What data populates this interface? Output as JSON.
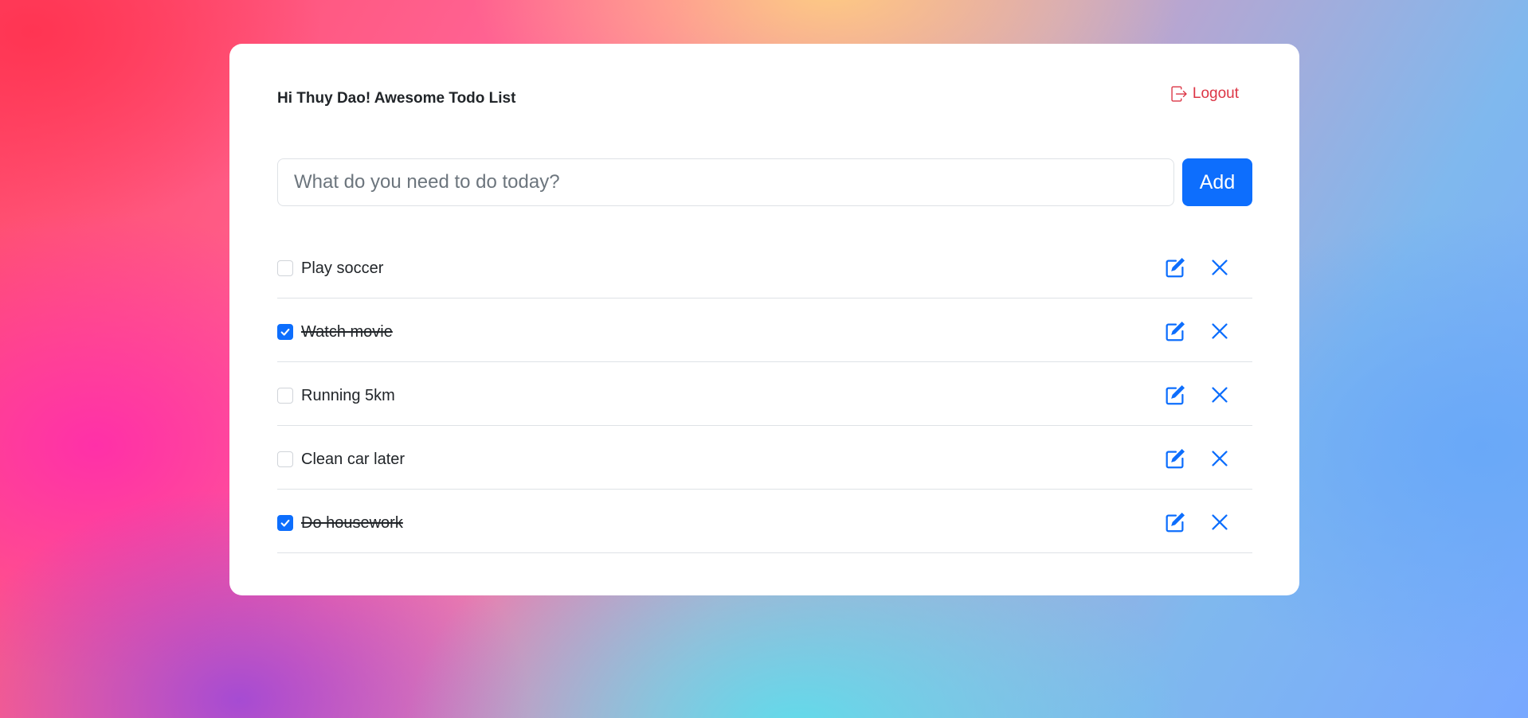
{
  "header": {
    "title": "Hi Thuy Dao! Awesome Todo List",
    "logout_label": "Logout"
  },
  "new_todo": {
    "placeholder": "What do you need to do today?",
    "value": "",
    "add_label": "Add"
  },
  "todos": [
    {
      "text": "Play soccer",
      "done": false
    },
    {
      "text": "Watch movie",
      "done": true
    },
    {
      "text": "Running 5km",
      "done": false
    },
    {
      "text": "Clean car later",
      "done": false
    },
    {
      "text": "Do housework",
      "done": true
    }
  ],
  "colors": {
    "primary": "#0d6efd",
    "danger": "#dc3545",
    "text": "#212529",
    "border": "#dee2e6"
  },
  "icons": {
    "logout": "box-arrow-right-icon",
    "edit": "pencil-square-icon",
    "delete": "x-icon",
    "checked": "check-icon"
  }
}
